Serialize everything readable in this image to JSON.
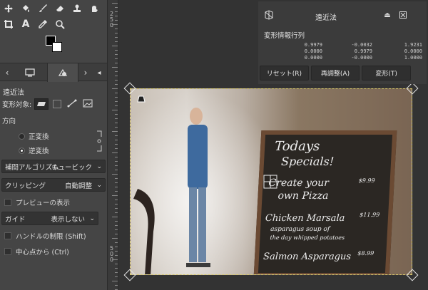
{
  "toolbox": {
    "tools": [
      {
        "icon": "move-icon",
        "glyph": "✥"
      },
      {
        "icon": "paint-bucket-icon",
        "glyph": "⛽"
      },
      {
        "icon": "brush-icon",
        "glyph": "✎"
      },
      {
        "icon": "eraser-icon",
        "glyph": "⌫"
      },
      {
        "icon": "clone-stamp-icon",
        "glyph": "⚲"
      },
      {
        "icon": "smudge-icon",
        "glyph": "☛"
      },
      {
        "icon": "crop-icon",
        "glyph": "⌗"
      },
      {
        "icon": "text-tool-icon",
        "glyph": "A"
      },
      {
        "icon": "color-picker-icon",
        "glyph": "✑"
      },
      {
        "icon": "zoom-icon",
        "glyph": "⚲"
      }
    ],
    "fg_color": "#000000",
    "bg_color": "#ffffff"
  },
  "tool_options": {
    "title": "遠近法",
    "transform_target_label": "変形対象:",
    "direction_label": "方向",
    "direction_options": [
      "正変換",
      "逆変換"
    ],
    "direction_selected": "逆変換",
    "interpolation_label": "補間アルゴリズム",
    "interpolation_value": "キュービック",
    "clipping_label": "クリッピング",
    "clipping_value": "自動調整",
    "preview_label": "プレビューの表示",
    "guide_label": "ガイド",
    "guide_value": "表示しない",
    "constrain_label": "ハンドルの制限 (Shift)",
    "from_center_label": "中心点から (Ctrl)"
  },
  "ruler": {
    "labels": [
      "2\n5\n0",
      "5\n0\n0"
    ]
  },
  "dialog": {
    "title": "遠近法",
    "matrix_label": "変形情報行列",
    "matrix": [
      [
        "0.9979",
        "-0.0032",
        "1.9231"
      ],
      [
        "0.0000",
        "0.9979",
        "0.0000"
      ],
      [
        "0.0000",
        "-0.0000",
        "1.0000"
      ]
    ],
    "buttons": {
      "reset": "リセット(R)",
      "readjust": "再調整(A)",
      "transform": "変形(T)"
    }
  },
  "photo": {
    "board_lines": [
      "Todays",
      "Specials!",
      "Create your",
      "own Pizza",
      "Chicken Marsala",
      "asparagus soup of",
      "the day whipped potatoes",
      "Salmon Asparagus"
    ],
    "price_labels": [
      "$9.99",
      "$11.99",
      "$8.99"
    ]
  }
}
